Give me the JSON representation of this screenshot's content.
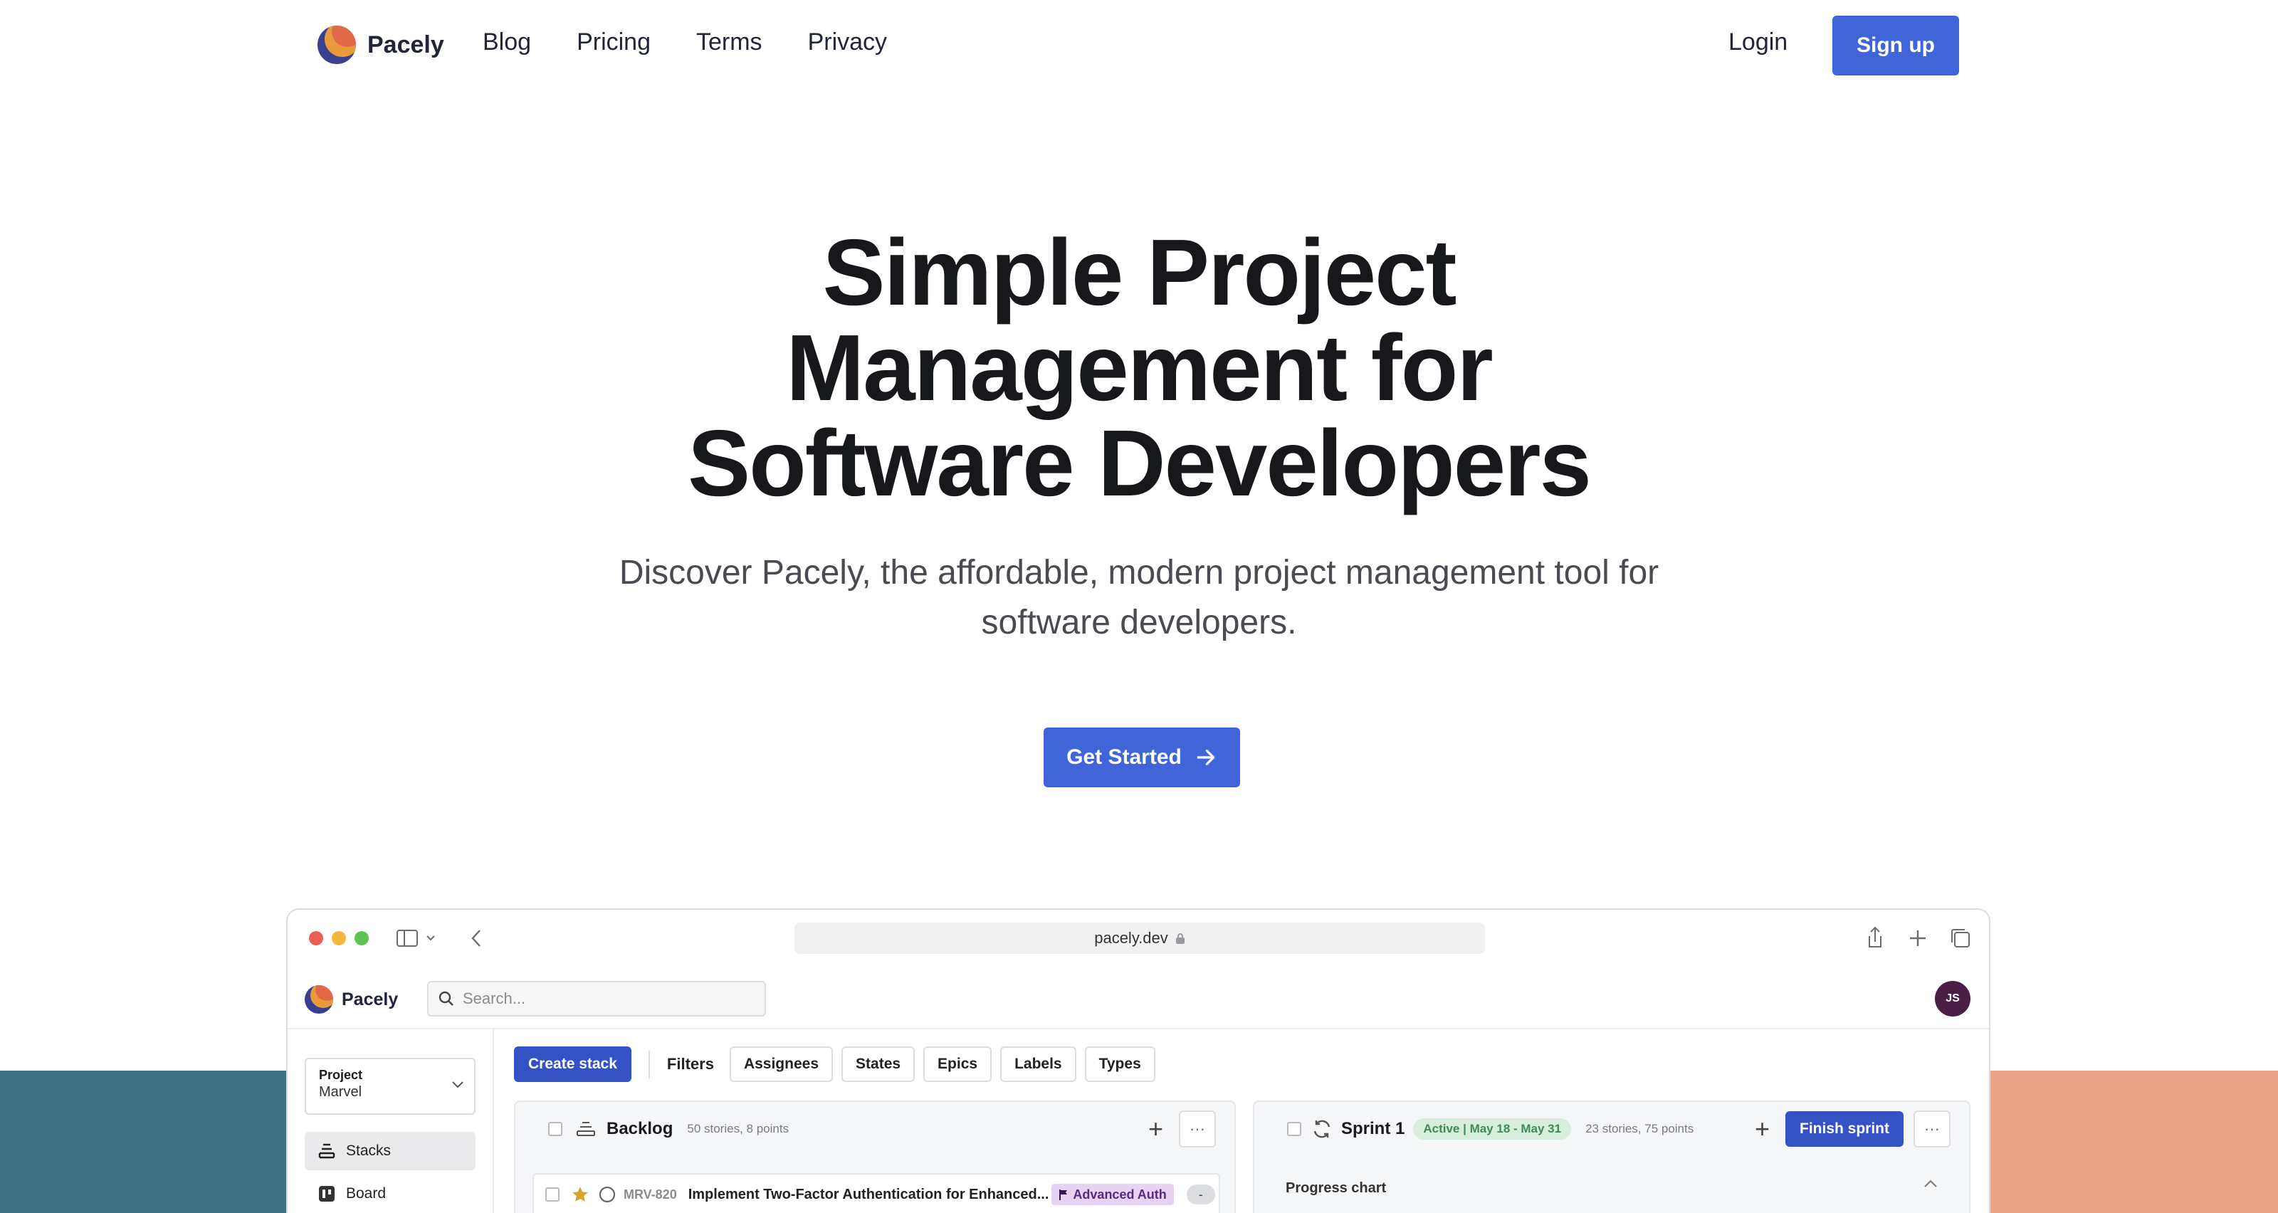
{
  "brand": {
    "name": "Pacely"
  },
  "nav": {
    "links": [
      "Blog",
      "Pricing",
      "Terms",
      "Privacy"
    ],
    "login": "Login",
    "signup": "Sign up"
  },
  "hero": {
    "title_lines": [
      "Simple Project",
      "Management for",
      "Software Developers"
    ],
    "subtitle_line1": "Discover Pacely, the affordable, modern project management tool for",
    "subtitle_line2": "software developers.",
    "cta": "Get Started",
    "cta_icon": "arrow-right-icon"
  },
  "colors": {
    "accent": "#3f65d8",
    "band_left": "#3d7282",
    "band_right": "#e9a487"
  },
  "browser": {
    "url": "pacely.dev",
    "url_icon": "lock-icon"
  },
  "app": {
    "brand": "Pacely",
    "search_placeholder": "Search...",
    "avatar_initials": "JS",
    "sidebar": {
      "project_label": "Project",
      "project_value": "Marvel",
      "items": [
        {
          "label": "Stacks",
          "icon": "stacks-icon",
          "active": true
        },
        {
          "label": "Board",
          "icon": "board-icon",
          "active": false
        }
      ]
    },
    "toolbar": {
      "create_stack": "Create stack",
      "filters_label": "Filters",
      "filters": [
        "Assignees",
        "States",
        "Epics",
        "Labels",
        "Types"
      ]
    },
    "backlog": {
      "title": "Backlog",
      "meta": "50 stories, 8 points",
      "story": {
        "id": "MRV-820",
        "title": "Implement Two-Factor Authentication for Enhanced...",
        "epic": "Advanced Auth",
        "points": "-"
      }
    },
    "sprint": {
      "title": "Sprint 1",
      "status": "Active | May 18 - May 31",
      "meta": "23 stories, 75 points",
      "finish": "Finish sprint",
      "progress_label": "Progress chart"
    }
  }
}
